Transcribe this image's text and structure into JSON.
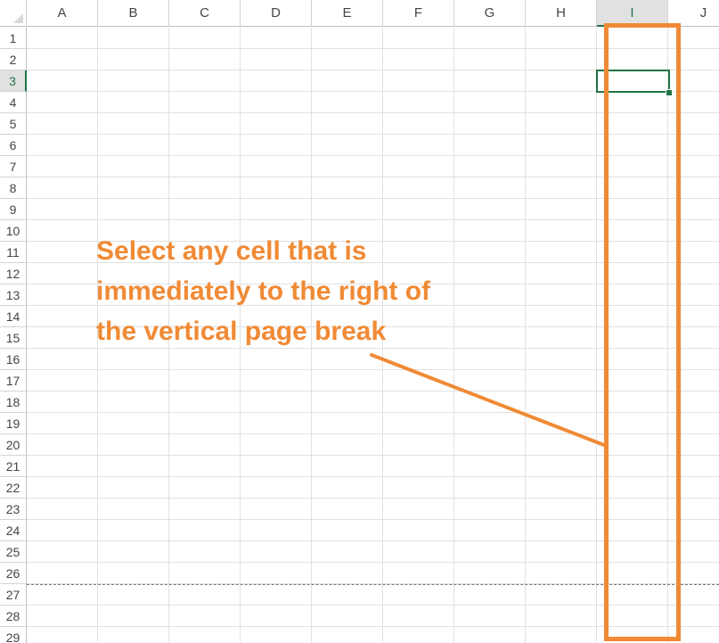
{
  "spreadsheet": {
    "columns": [
      "A",
      "B",
      "C",
      "D",
      "E",
      "F",
      "G",
      "H",
      "I",
      "J"
    ],
    "rows": [
      "1",
      "2",
      "3",
      "4",
      "5",
      "6",
      "7",
      "8",
      "9",
      "10",
      "11",
      "12",
      "13",
      "14",
      "15",
      "16",
      "17",
      "18",
      "19",
      "20",
      "21",
      "22",
      "23",
      "24",
      "25",
      "26",
      "27",
      "28",
      "29"
    ],
    "active_column": "I",
    "active_row": "3"
  },
  "annotation": {
    "lines": [
      "Select any cell that is",
      "immediately to the right of",
      "the vertical page break"
    ]
  },
  "colors": {
    "annotation_orange": "#f08a35",
    "selection_green": "#217346"
  }
}
